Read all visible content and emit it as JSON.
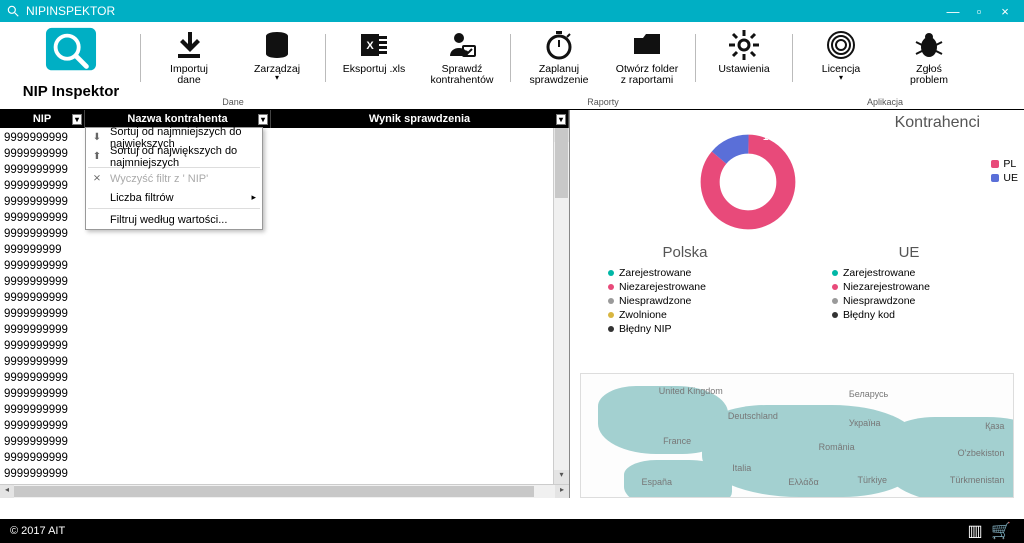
{
  "window": {
    "title": "NIPINSPEKTOR"
  },
  "brand": {
    "label": "NIP Inspektor"
  },
  "ribbon": {
    "groups": [
      {
        "label": "Dane",
        "items": [
          {
            "name": "importuj-dane",
            "label": "Importuj\ndane"
          },
          {
            "name": "zarzadzaj",
            "label": "Zarządzaj",
            "dropdown": true
          }
        ]
      },
      {
        "label": "",
        "items": [
          {
            "name": "eksportuj-xls",
            "label": "Eksportuj .xls"
          },
          {
            "name": "sprawdz-kontrahentow",
            "label": "Sprawdź\nkontrahentów"
          }
        ]
      },
      {
        "label": "Raporty",
        "items": [
          {
            "name": "zaplanuj-sprawdzenie",
            "label": "Zaplanuj\nsprawdzenie"
          },
          {
            "name": "otworz-folder",
            "label": "Otwórz folder\nz raportami"
          }
        ]
      },
      {
        "label": "",
        "items": [
          {
            "name": "ustawienia",
            "label": "Ustawienia"
          }
        ]
      },
      {
        "label": "Aplikacja",
        "items": [
          {
            "name": "licencja",
            "label": "Licencja",
            "dropdown": true
          },
          {
            "name": "zglos-problem",
            "label": "Zgłoś\nproblem"
          }
        ]
      }
    ]
  },
  "grid": {
    "columns": {
      "nip": "NIP",
      "name": "Nazwa kontrahenta",
      "result": "Wynik sprawdzenia"
    },
    "rows": [
      "9999999999",
      "9999999999",
      "9999999999",
      "9999999999",
      "9999999999",
      "9999999999",
      "9999999999",
      "999999999",
      "9999999999",
      "9999999999",
      "9999999999",
      "9999999999",
      "9999999999",
      "9999999999",
      "9999999999",
      "9999999999",
      "9999999999",
      "9999999999",
      "9999999999",
      "9999999999",
      "9999999999",
      "9999999999"
    ]
  },
  "context_menu": {
    "sort_asc": "Sortuj od najmniejszych do największych",
    "sort_desc": "Sortuj od największych do najmniejszych",
    "clear_filter": "Wyczyść filtr z ' NIP'",
    "filter_count": "Liczba filtrów",
    "filter_by_value": "Filtruj według wartości..."
  },
  "right_panel": {
    "title": "Kontrahenci",
    "chart_data": {
      "type": "pie",
      "title": "Kontrahenci",
      "series": [
        {
          "name": "PL",
          "value": 85,
          "color": "#e84a7a"
        },
        {
          "name": "UE",
          "value": 14,
          "color": "#5a6fd8"
        }
      ]
    },
    "legend": [
      {
        "label": "PL",
        "color": "#e84a7a"
      },
      {
        "label": "UE",
        "color": "#5a6fd8"
      }
    ],
    "stats": {
      "pl": {
        "title": "Polska",
        "items": [
          {
            "label": "Zarejestrowane",
            "color": "#00b7a6"
          },
          {
            "label": "Niezarejestrowane",
            "color": "#e84a7a"
          },
          {
            "label": "Niesprawdzone",
            "color": "#9a9a9a"
          },
          {
            "label": "Zwolnione",
            "color": "#d8b641"
          },
          {
            "label": "Błędny NIP",
            "color": "#333333"
          }
        ]
      },
      "ue": {
        "title": "UE",
        "items": [
          {
            "label": "Zarejestrowane",
            "color": "#00b7a6"
          },
          {
            "label": "Niezarejestrowane",
            "color": "#e84a7a"
          },
          {
            "label": "Niesprawdzone",
            "color": "#9a9a9a"
          },
          {
            "label": "Błędny kod",
            "color": "#333333"
          }
        ]
      }
    },
    "map_labels": [
      "United Kingdom",
      "Беларусь",
      "Deutschland",
      "Україна",
      "France",
      "România",
      "Қаза",
      "España",
      "Ελλάδα",
      "Türkiye",
      "Türkmenistan",
      "Italia",
      "O'zbekiston"
    ]
  },
  "footer": {
    "copyright": "© 2017 AIT"
  }
}
